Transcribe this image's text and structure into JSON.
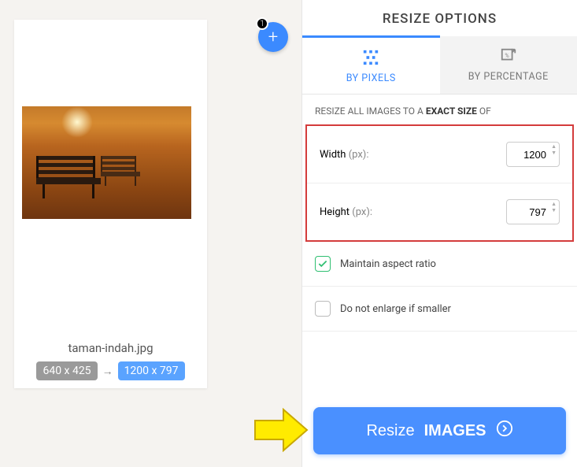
{
  "header": {
    "title": "RESIZE OPTIONS"
  },
  "tabs": {
    "pixels": "BY PIXELS",
    "percentage": "BY PERCENTAGE"
  },
  "desc": {
    "prefix": "RESIZE ALL IMAGES TO A ",
    "bold": "EXACT SIZE",
    "suffix": " OF"
  },
  "dimensions": {
    "width_label": "Width",
    "width_unit": "(px):",
    "width_value": "1200",
    "height_label": "Height",
    "height_unit": "(px):",
    "height_value": "797"
  },
  "options": {
    "maintain": "Maintain aspect ratio",
    "noenlarge": "Do not enlarge if smaller"
  },
  "action": {
    "resize_prefix": "Resize",
    "resize_bold": "IMAGES"
  },
  "add": {
    "count": "1",
    "plus": "+"
  },
  "card": {
    "filename": "taman-indah.jpg",
    "orig": "640 x 425",
    "arrow": "→",
    "target": "1200 x 797"
  }
}
